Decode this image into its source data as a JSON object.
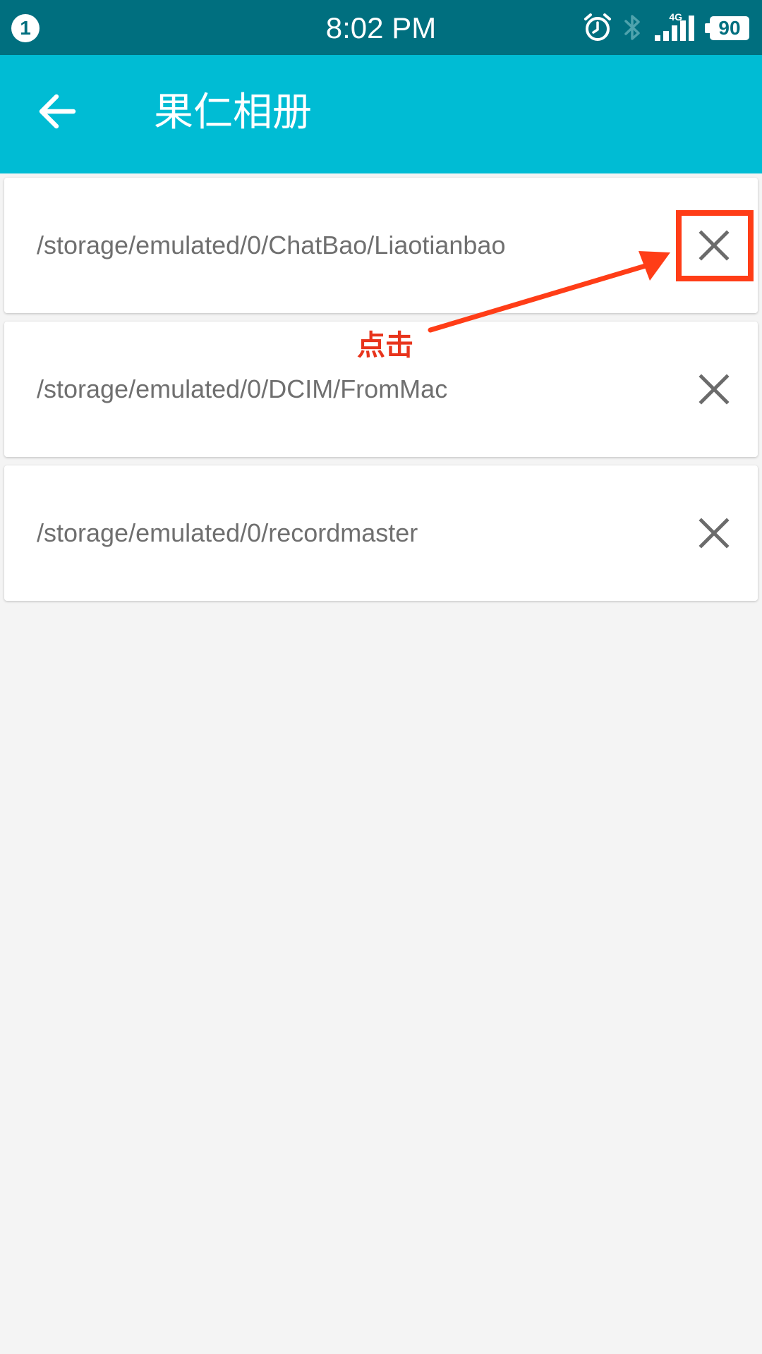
{
  "status_bar": {
    "notification_count": "1",
    "time": "8:02 PM",
    "network": "4G",
    "battery": "90",
    "icons": [
      "alarm-icon",
      "bluetooth-icon",
      "signal-icon",
      "battery-icon"
    ]
  },
  "app_bar": {
    "back_icon": "arrow-back-icon",
    "title": "果仁相册"
  },
  "folders": [
    {
      "path": "/storage/emulated/0/ChatBao/Liaotianbao",
      "remove_icon": "close-icon"
    },
    {
      "path": "/storage/emulated/0/DCIM/FromMac",
      "remove_icon": "close-icon"
    },
    {
      "path": "/storage/emulated/0/recordmaster",
      "remove_icon": "close-icon"
    }
  ],
  "annotation": {
    "label": "点击",
    "color": "#ff3d17"
  },
  "colors": {
    "status_bar": "#006f7f",
    "app_bar": "#00bcd4",
    "background": "#f4f4f4",
    "path_text": "#6f6f6f"
  }
}
